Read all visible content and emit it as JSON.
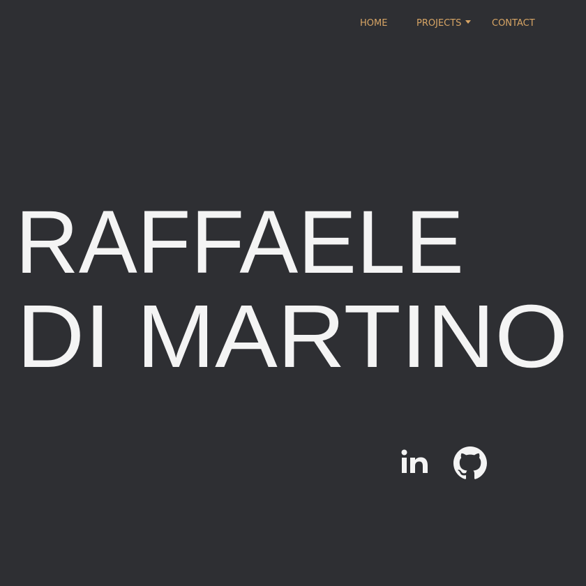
{
  "nav": {
    "items": [
      {
        "label": "HOME"
      },
      {
        "label": "PROJECTS",
        "has_dropdown": true
      },
      {
        "label": "CONTACT"
      }
    ]
  },
  "hero": {
    "first_line": "RAFFAELE",
    "second_line": "DI MARTINO"
  },
  "social": {
    "items": [
      {
        "icon": "linkedin-icon"
      },
      {
        "icon": "github-icon"
      }
    ]
  },
  "colors": {
    "background": "#2e2f33",
    "accent": "#d8a565",
    "text": "#f4f4f4"
  }
}
